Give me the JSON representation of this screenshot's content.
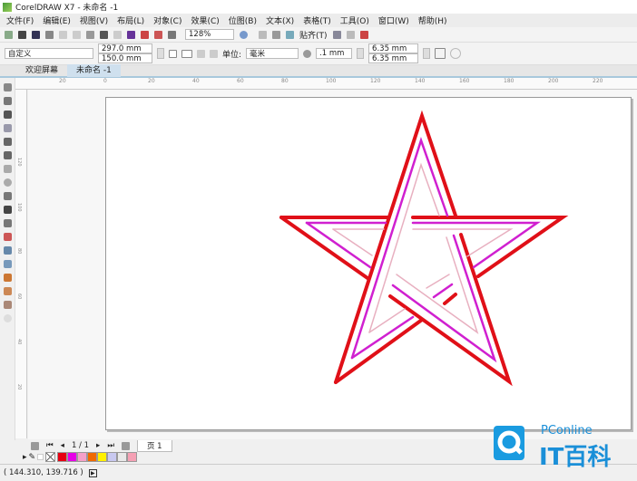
{
  "window": {
    "title": "CorelDRAW X7 - 未命名 -1"
  },
  "menu": [
    "文件(F)",
    "编辑(E)",
    "视图(V)",
    "布局(L)",
    "对象(C)",
    "效果(C)",
    "位图(B)",
    "文本(X)",
    "表格(T)",
    "工具(O)",
    "窗口(W)",
    "帮助(H)"
  ],
  "toolbar": {
    "zoom": "128%",
    "snap_label": "贴齐(T)"
  },
  "property_bar": {
    "preset": "自定义",
    "width": "297.0 mm",
    "height": "150.0 mm",
    "units_label": "单位:",
    "units": "毫米",
    "nudge": ".1 mm",
    "dup_x": "6.35 mm",
    "dup_y": "6.35 mm"
  },
  "tabs": [
    {
      "label": "欢迎屏幕"
    },
    {
      "label": "未命名 -1"
    }
  ],
  "ruler": {
    "h_ticks": [
      "20",
      "0",
      "20",
      "40",
      "60",
      "80",
      "100",
      "120",
      "140",
      "160",
      "180",
      "200",
      "220"
    ],
    "v_ticks": [
      "120",
      "100",
      "80",
      "60",
      "40",
      "20"
    ]
  },
  "pager": {
    "pages": "1 / 1",
    "page_tab": "页 1"
  },
  "palette": [
    "#e60012",
    "#e600e6",
    "#f5a0c8",
    "#f06a00",
    "#fff000",
    "#c8c8f0",
    "#e8e8e8",
    "#f5a0b4"
  ],
  "status": {
    "coords": "( 144.310, 139.716 )"
  },
  "watermark": {
    "text": "PConline",
    "logo_text": "IT百科"
  },
  "colors": {
    "star_outer": "#e01018",
    "star_mid": "#d020d0",
    "star_inner": "#e8b0c0"
  }
}
